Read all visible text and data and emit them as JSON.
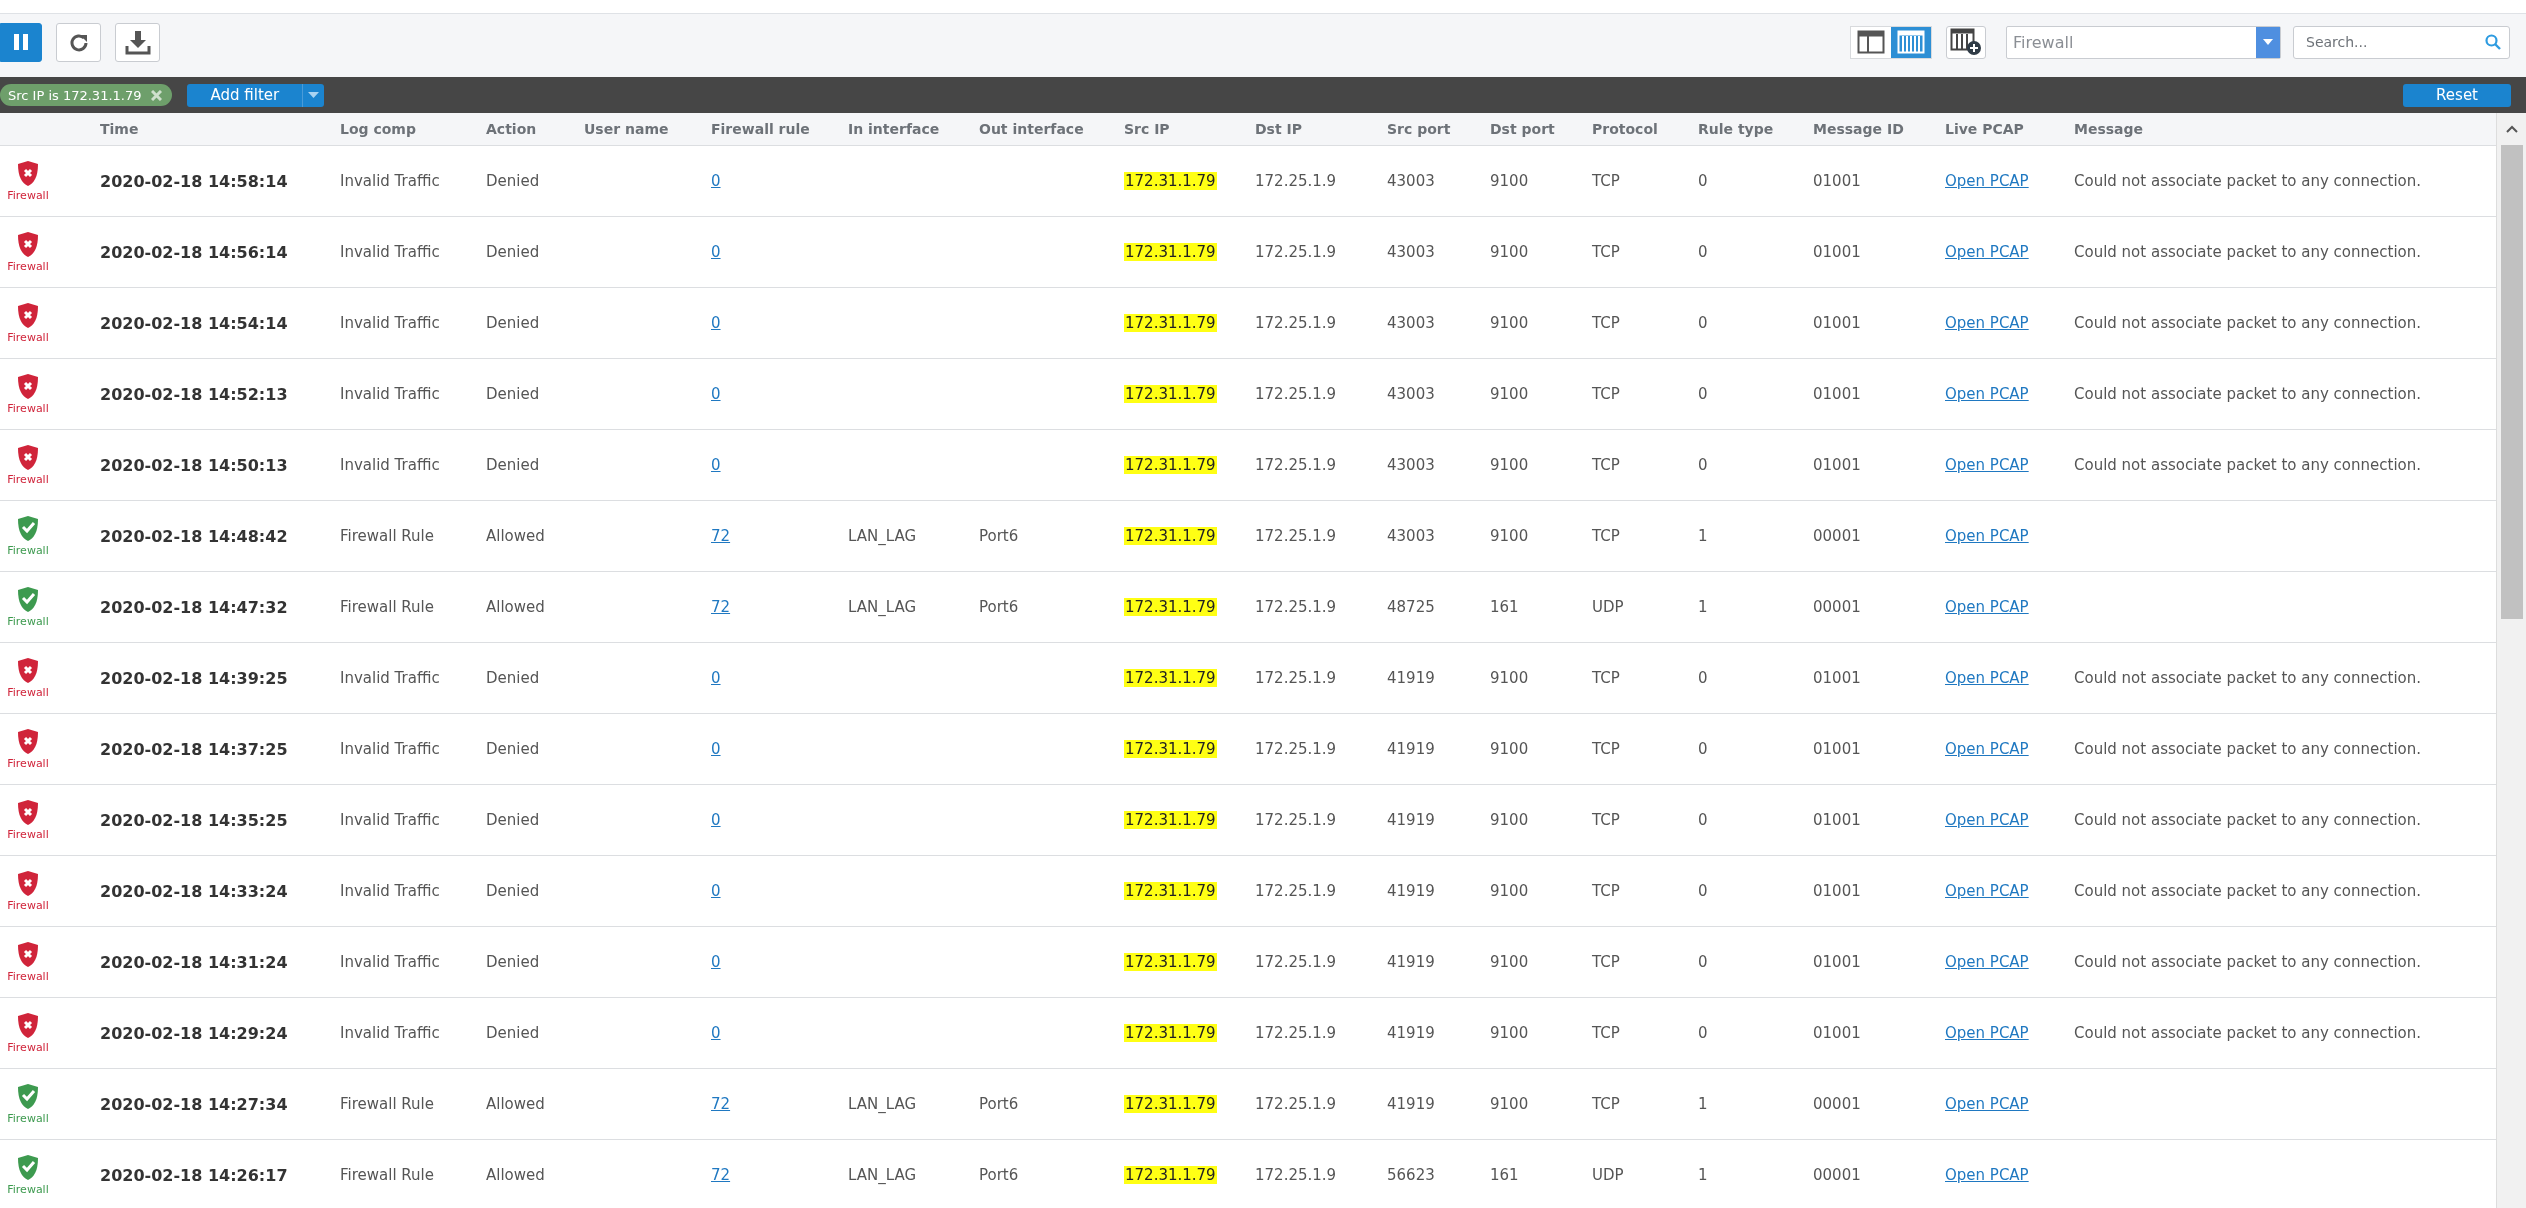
{
  "toolbar": {
    "buttons": [
      {
        "kind": "pause",
        "selected": true
      },
      {
        "kind": "refresh",
        "selected": false
      },
      {
        "kind": "download",
        "selected": false
      }
    ],
    "views": [
      {
        "kind": "panes",
        "selected": false
      },
      {
        "kind": "columns",
        "selected": true
      }
    ],
    "log_type": {
      "value": "Firewall"
    },
    "search": {
      "placeholder": "Search..."
    }
  },
  "filters": {
    "chips": [
      {
        "label": "Src IP is 172.31.1.79"
      }
    ],
    "add_filter": "Add filter",
    "reset": "Reset"
  },
  "table": {
    "columns": [
      "Time",
      "Log comp",
      "Action",
      "User name",
      "Firewall rule",
      "In interface",
      "Out interface",
      "Src IP",
      "Dst IP",
      "Src port",
      "Dst port",
      "Protocol",
      "Rule type",
      "Message ID",
      "Live PCAP",
      "Message"
    ],
    "rows": [
      {
        "kind": "denied",
        "source": "Firewall",
        "time": "2020-02-18 14:58:14",
        "log_comp": "Invalid Traffic",
        "action": "Denied",
        "firewall_rule": "0",
        "in_interface": "",
        "out_interface": "",
        "src_ip": "172.31.1.79",
        "src_ip_highlighted": true,
        "dst_ip": "172.25.1.9",
        "src_port": "43003",
        "dst_port": "9100",
        "protocol": "TCP",
        "rule_type": "0",
        "message_id": "01001",
        "live_pcap": "Open PCAP",
        "message": "Could not associate packet to any connection."
      },
      {
        "kind": "denied",
        "source": "Firewall",
        "time": "2020-02-18 14:56:14",
        "log_comp": "Invalid Traffic",
        "action": "Denied",
        "firewall_rule": "0",
        "in_interface": "",
        "out_interface": "",
        "src_ip": "172.31.1.79",
        "src_ip_highlighted": true,
        "dst_ip": "172.25.1.9",
        "src_port": "43003",
        "dst_port": "9100",
        "protocol": "TCP",
        "rule_type": "0",
        "message_id": "01001",
        "live_pcap": "Open PCAP",
        "message": "Could not associate packet to any connection."
      },
      {
        "kind": "denied",
        "source": "Firewall",
        "time": "2020-02-18 14:54:14",
        "log_comp": "Invalid Traffic",
        "action": "Denied",
        "firewall_rule": "0",
        "in_interface": "",
        "out_interface": "",
        "src_ip": "172.31.1.79",
        "src_ip_highlighted": true,
        "dst_ip": "172.25.1.9",
        "src_port": "43003",
        "dst_port": "9100",
        "protocol": "TCP",
        "rule_type": "0",
        "message_id": "01001",
        "live_pcap": "Open PCAP",
        "message": "Could not associate packet to any connection."
      },
      {
        "kind": "denied",
        "source": "Firewall",
        "time": "2020-02-18 14:52:13",
        "log_comp": "Invalid Traffic",
        "action": "Denied",
        "firewall_rule": "0",
        "in_interface": "",
        "out_interface": "",
        "src_ip": "172.31.1.79",
        "src_ip_highlighted": true,
        "dst_ip": "172.25.1.9",
        "src_port": "43003",
        "dst_port": "9100",
        "protocol": "TCP",
        "rule_type": "0",
        "message_id": "01001",
        "live_pcap": "Open PCAP",
        "message": "Could not associate packet to any connection."
      },
      {
        "kind": "denied",
        "source": "Firewall",
        "time": "2020-02-18 14:50:13",
        "log_comp": "Invalid Traffic",
        "action": "Denied",
        "firewall_rule": "0",
        "in_interface": "",
        "out_interface": "",
        "src_ip": "172.31.1.79",
        "src_ip_highlighted": true,
        "dst_ip": "172.25.1.9",
        "src_port": "43003",
        "dst_port": "9100",
        "protocol": "TCP",
        "rule_type": "0",
        "message_id": "01001",
        "live_pcap": "Open PCAP",
        "message": "Could not associate packet to any connection."
      },
      {
        "kind": "allowed",
        "source": "Firewall",
        "time": "2020-02-18 14:48:42",
        "log_comp": "Firewall Rule",
        "action": "Allowed",
        "firewall_rule": "72",
        "in_interface": "LAN_LAG",
        "out_interface": "Port6",
        "src_ip": "172.31.1.79",
        "src_ip_highlighted": true,
        "dst_ip": "172.25.1.9",
        "src_port": "43003",
        "dst_port": "9100",
        "protocol": "TCP",
        "rule_type": "1",
        "message_id": "00001",
        "live_pcap": "Open PCAP",
        "message": ""
      },
      {
        "kind": "allowed",
        "source": "Firewall",
        "time": "2020-02-18 14:47:32",
        "log_comp": "Firewall Rule",
        "action": "Allowed",
        "firewall_rule": "72",
        "in_interface": "LAN_LAG",
        "out_interface": "Port6",
        "src_ip": "172.31.1.79",
        "src_ip_highlighted": true,
        "dst_ip": "172.25.1.9",
        "src_port": "48725",
        "dst_port": "161",
        "protocol": "UDP",
        "rule_type": "1",
        "message_id": "00001",
        "live_pcap": "Open PCAP",
        "message": ""
      },
      {
        "kind": "denied",
        "source": "Firewall",
        "time": "2020-02-18 14:39:25",
        "log_comp": "Invalid Traffic",
        "action": "Denied",
        "firewall_rule": "0",
        "in_interface": "",
        "out_interface": "",
        "src_ip": "172.31.1.79",
        "src_ip_highlighted": true,
        "dst_ip": "172.25.1.9",
        "src_port": "41919",
        "dst_port": "9100",
        "protocol": "TCP",
        "rule_type": "0",
        "message_id": "01001",
        "live_pcap": "Open PCAP",
        "message": "Could not associate packet to any connection."
      },
      {
        "kind": "denied",
        "source": "Firewall",
        "time": "2020-02-18 14:37:25",
        "log_comp": "Invalid Traffic",
        "action": "Denied",
        "firewall_rule": "0",
        "in_interface": "",
        "out_interface": "",
        "src_ip": "172.31.1.79",
        "src_ip_highlighted": true,
        "dst_ip": "172.25.1.9",
        "src_port": "41919",
        "dst_port": "9100",
        "protocol": "TCP",
        "rule_type": "0",
        "message_id": "01001",
        "live_pcap": "Open PCAP",
        "message": "Could not associate packet to any connection."
      },
      {
        "kind": "denied",
        "source": "Firewall",
        "time": "2020-02-18 14:35:25",
        "log_comp": "Invalid Traffic",
        "action": "Denied",
        "firewall_rule": "0",
        "in_interface": "",
        "out_interface": "",
        "src_ip": "172.31.1.79",
        "src_ip_highlighted": true,
        "dst_ip": "172.25.1.9",
        "src_port": "41919",
        "dst_port": "9100",
        "protocol": "TCP",
        "rule_type": "0",
        "message_id": "01001",
        "live_pcap": "Open PCAP",
        "message": "Could not associate packet to any connection."
      },
      {
        "kind": "denied",
        "source": "Firewall",
        "time": "2020-02-18 14:33:24",
        "log_comp": "Invalid Traffic",
        "action": "Denied",
        "firewall_rule": "0",
        "in_interface": "",
        "out_interface": "",
        "src_ip": "172.31.1.79",
        "src_ip_highlighted": true,
        "dst_ip": "172.25.1.9",
        "src_port": "41919",
        "dst_port": "9100",
        "protocol": "TCP",
        "rule_type": "0",
        "message_id": "01001",
        "live_pcap": "Open PCAP",
        "message": "Could not associate packet to any connection."
      },
      {
        "kind": "denied",
        "source": "Firewall",
        "time": "2020-02-18 14:31:24",
        "log_comp": "Invalid Traffic",
        "action": "Denied",
        "firewall_rule": "0",
        "in_interface": "",
        "out_interface": "",
        "src_ip": "172.31.1.79",
        "src_ip_highlighted": true,
        "dst_ip": "172.25.1.9",
        "src_port": "41919",
        "dst_port": "9100",
        "protocol": "TCP",
        "rule_type": "0",
        "message_id": "01001",
        "live_pcap": "Open PCAP",
        "message": "Could not associate packet to any connection."
      },
      {
        "kind": "denied",
        "source": "Firewall",
        "time": "2020-02-18 14:29:24",
        "log_comp": "Invalid Traffic",
        "action": "Denied",
        "firewall_rule": "0",
        "in_interface": "",
        "out_interface": "",
        "src_ip": "172.31.1.79",
        "src_ip_highlighted": true,
        "dst_ip": "172.25.1.9",
        "src_port": "41919",
        "dst_port": "9100",
        "protocol": "TCP",
        "rule_type": "0",
        "message_id": "01001",
        "live_pcap": "Open PCAP",
        "message": "Could not associate packet to any connection."
      },
      {
        "kind": "allowed",
        "source": "Firewall",
        "time": "2020-02-18 14:27:34",
        "log_comp": "Firewall Rule",
        "action": "Allowed",
        "firewall_rule": "72",
        "in_interface": "LAN_LAG",
        "out_interface": "Port6",
        "src_ip": "172.31.1.79",
        "src_ip_highlighted": true,
        "dst_ip": "172.25.1.9",
        "src_port": "41919",
        "dst_port": "9100",
        "protocol": "TCP",
        "rule_type": "1",
        "message_id": "00001",
        "live_pcap": "Open PCAP",
        "message": ""
      },
      {
        "kind": "allowed",
        "source": "Firewall",
        "time": "2020-02-18 14:26:17",
        "log_comp": "Firewall Rule",
        "action": "Allowed",
        "firewall_rule": "72",
        "in_interface": "LAN_LAG",
        "out_interface": "Port6",
        "src_ip": "172.31.1.79",
        "src_ip_highlighted": true,
        "dst_ip": "172.25.1.9",
        "src_port": "56623",
        "dst_port": "161",
        "protocol": "UDP",
        "rule_type": "1",
        "message_id": "00001",
        "live_pcap": "Open PCAP",
        "message": ""
      }
    ]
  }
}
